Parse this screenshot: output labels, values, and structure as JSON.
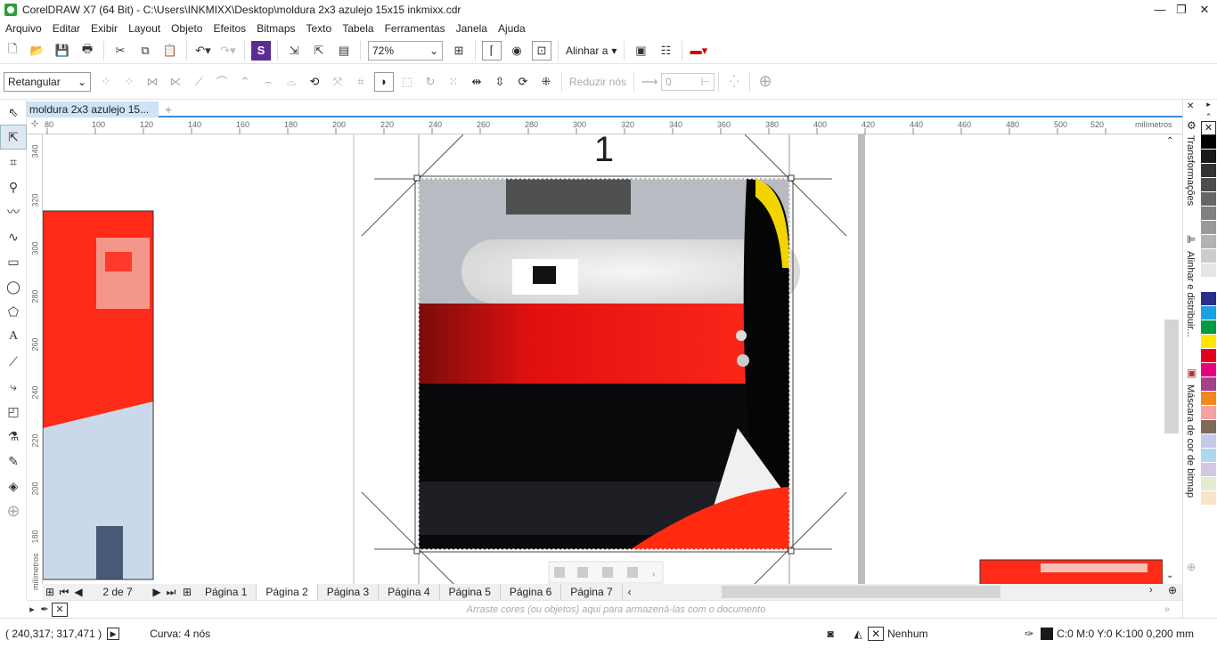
{
  "window": {
    "title": "CorelDRAW X7 (64 Bit) - C:\\Users\\INKMIXX\\Desktop\\moldura 2x3 azulejo 15x15 inkmixx.cdr",
    "minimize": "—",
    "restore": "❐",
    "close": "✕"
  },
  "menu": [
    "Arquivo",
    "Editar",
    "Exibir",
    "Layout",
    "Objeto",
    "Efeitos",
    "Bitmaps",
    "Texto",
    "Tabela",
    "Ferramentas",
    "Janela",
    "Ajuda"
  ],
  "toolbar": {
    "zoom": "72%",
    "align_label": "Alinhar a"
  },
  "property_bar": {
    "mode": "Retangular",
    "reduce_nodes": "Reduzir nós",
    "smoothness": "0"
  },
  "document_tab": {
    "label": "moldura 2x3 azulejo 15...",
    "plus": "+"
  },
  "ruler": {
    "units": "milímetros",
    "h_ticks": [
      "80",
      "100",
      "120",
      "140",
      "160",
      "180",
      "200",
      "220",
      "240",
      "260",
      "280",
      "300",
      "320",
      "340",
      "360",
      "380",
      "400",
      "420",
      "440",
      "460",
      "480",
      "500",
      "520"
    ],
    "v_ticks": [
      "340",
      "320",
      "300",
      "280",
      "260",
      "240",
      "220",
      "200",
      "180"
    ]
  },
  "canvas": {
    "page_number": "1"
  },
  "page_nav": {
    "counter": "2 de 7",
    "pages": [
      "Página 1",
      "Página 2",
      "Página 3",
      "Página 4",
      "Página 5",
      "Página 6",
      "Página 7"
    ],
    "active_page": "Página 2"
  },
  "color_tray": {
    "hint": "Arraste cores (ou objetos) aqui para armazená-las com o documento"
  },
  "status": {
    "coords": "( 240,317; 317,471 )",
    "object_info": "Curva: 4 nós",
    "fill_label": "Nenhum",
    "outline_label": "C:0 M:0 Y:0 K:100  0,200 mm"
  },
  "dockers": [
    "Transformações",
    "Alinhar e distribuir...",
    "Máscara de cor de bitmap"
  ],
  "palette": [
    "#ffffff",
    "#000000",
    "#1a1a1a",
    "#333333",
    "#4d4d4d",
    "#666666",
    "#808080",
    "#999999",
    "#b3b3b3",
    "#cccccc",
    "#e6e6e6",
    "#ffffff",
    "#2b2f8c",
    "#1aa1e0",
    "#009a44",
    "#ffe600",
    "#e3001b",
    "#e6007e",
    "#a3418a",
    "#f08a1c",
    "#f4a3a0",
    "#7f6a5c",
    "#c5c8e8",
    "#b0d7f0",
    "#d3c7e2",
    "#e2ecd0",
    "#fbe3c8",
    "#ffffff"
  ]
}
